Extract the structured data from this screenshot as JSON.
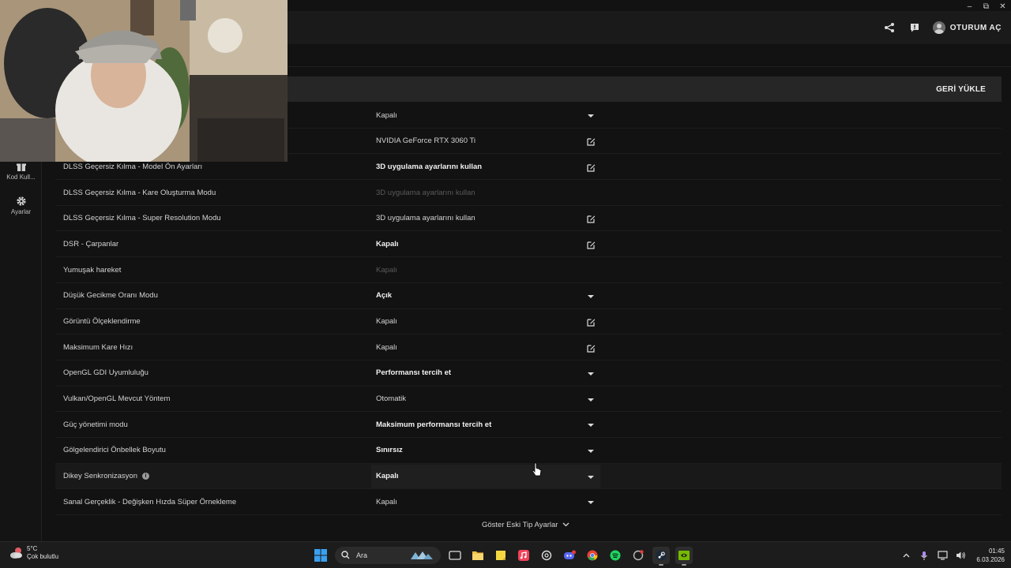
{
  "header": {
    "login_label": "OTURUM AÇ"
  },
  "sidebar": {
    "items": [
      {
        "label": "Kod Kull...",
        "icon": "gift-icon"
      },
      {
        "label": "Ayarlar",
        "icon": "gear-icon"
      }
    ]
  },
  "panel": {
    "restore_label": "GERİ YÜKLE",
    "rows": [
      {
        "label": "",
        "value": "Kapalı",
        "style": "normal",
        "control": "dropdown"
      },
      {
        "label": "",
        "value": "NVIDIA GeForce RTX 3060 Ti",
        "style": "normal",
        "control": "edit"
      },
      {
        "label": "DLSS Geçersiz Kılma - Model Ön Ayarları",
        "value": "3D uygulama ayarlarını kullan",
        "style": "bold",
        "control": "edit"
      },
      {
        "label": "DLSS Geçersiz Kılma - Kare Oluşturma Modu",
        "value": "3D uygulama ayarlarını kullan",
        "style": "dim",
        "control": "none"
      },
      {
        "label": "DLSS Geçersiz Kılma - Super Resolution Modu",
        "value": "3D uygulama ayarlarını kullan",
        "style": "normal",
        "control": "edit"
      },
      {
        "label": "DSR - Çarpanlar",
        "value": "Kapalı",
        "style": "bold",
        "control": "edit"
      },
      {
        "label": "Yumuşak hareket",
        "value": "Kapalı",
        "style": "dim",
        "control": "none"
      },
      {
        "label": "Düşük Gecikme Oranı Modu",
        "value": "Açık",
        "style": "bold",
        "control": "dropdown"
      },
      {
        "label": "Görüntü Ölçeklendirme",
        "value": "Kapalı",
        "style": "normal",
        "control": "edit"
      },
      {
        "label": "Maksimum Kare Hızı",
        "value": "Kapalı",
        "style": "normal",
        "control": "edit"
      },
      {
        "label": "OpenGL GDI Uyumluluğu",
        "value": "Performansı tercih et",
        "style": "bold",
        "control": "dropdown"
      },
      {
        "label": "Vulkan/OpenGL Mevcut Yöntem",
        "value": "Otomatik",
        "style": "normal",
        "control": "dropdown"
      },
      {
        "label": "Güç yönetimi modu",
        "value": "Maksimum performansı tercih et",
        "style": "bold",
        "control": "dropdown"
      },
      {
        "label": "Gölgelendirici Önbellek Boyutu",
        "value": "Sınırsız",
        "style": "bold",
        "control": "dropdown"
      },
      {
        "label": "Dikey Senkronizasyon",
        "value": "Kapalı",
        "style": "bold",
        "control": "dropdown",
        "info": true,
        "highlight": true
      },
      {
        "label": "Sanal Gerçeklik - Değişken Hızda Süper Örnekleme",
        "value": "Kapalı",
        "style": "normal",
        "control": "dropdown"
      }
    ],
    "legacy_label": "Göster Eski Tip Ayarlar"
  },
  "taskbar": {
    "weather_temp": "5°C",
    "weather_desc": "Çok bulutlu",
    "search_placeholder": "Ara",
    "time": "01:45",
    "date": "6.03.2026"
  },
  "colors": {
    "background": "#121212",
    "panel_header": "#262626",
    "text": "#d4d4d4"
  }
}
